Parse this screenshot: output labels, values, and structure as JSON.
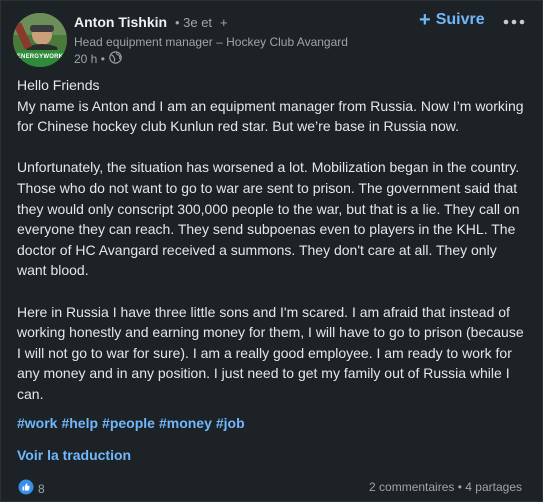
{
  "post": {
    "author": {
      "name": "Anton Tishkin",
      "degree": "• 3e et",
      "connect_mark": "+",
      "headline": "Head equipment manager – Hockey Club Avangard",
      "time": "20 h •",
      "avatar_badge": "ENERGYWORK"
    },
    "follow_label": "Suivre",
    "paragraphs": [
      [
        "Hello Friends",
        "My name is Anton and I am an equipment manager from Russia. Now I’m working for Chinese hockey club Kunlun red star. But we’re base in Russia now."
      ],
      [
        "Unfortunately, the situation has worsened a lot. Mobilization began in the country. Those who do not want to go to war are sent to prison. The government said that they would only conscript 300,000 people to the war, but that is a lie. They call on everyone they can reach. They send subpoenas even to players in the KHL. The doctor of HC Avangard received a summons. They don't care at all. They only want blood."
      ],
      [
        "Here in Russia I have three little sons and I'm scared. I am afraid that instead of working honestly and earning money for them, I will have to go to prison (because I will not go to war for sure). I am a really good employee. I am ready to work for any money and in any position. I just need to get my family out of Russia while I can."
      ]
    ],
    "hashtags": [
      "#work",
      "#help",
      "#people",
      "#money",
      "#job"
    ],
    "translate_label": "Voir la traduction",
    "reactions_count": "8",
    "comments_label": "2 commentaires",
    "separator": " • ",
    "shares_label": "4 partages"
  },
  "colors": {
    "background": "#1d2226",
    "accent": "#71b7fb",
    "text": "#e6e6e6",
    "muted": "#a0a4a8",
    "reaction_like": "#378fe9"
  },
  "icons": {
    "visibility": "globe-icon",
    "more": "ellipsis-icon",
    "reaction": "like-reaction-icon"
  }
}
